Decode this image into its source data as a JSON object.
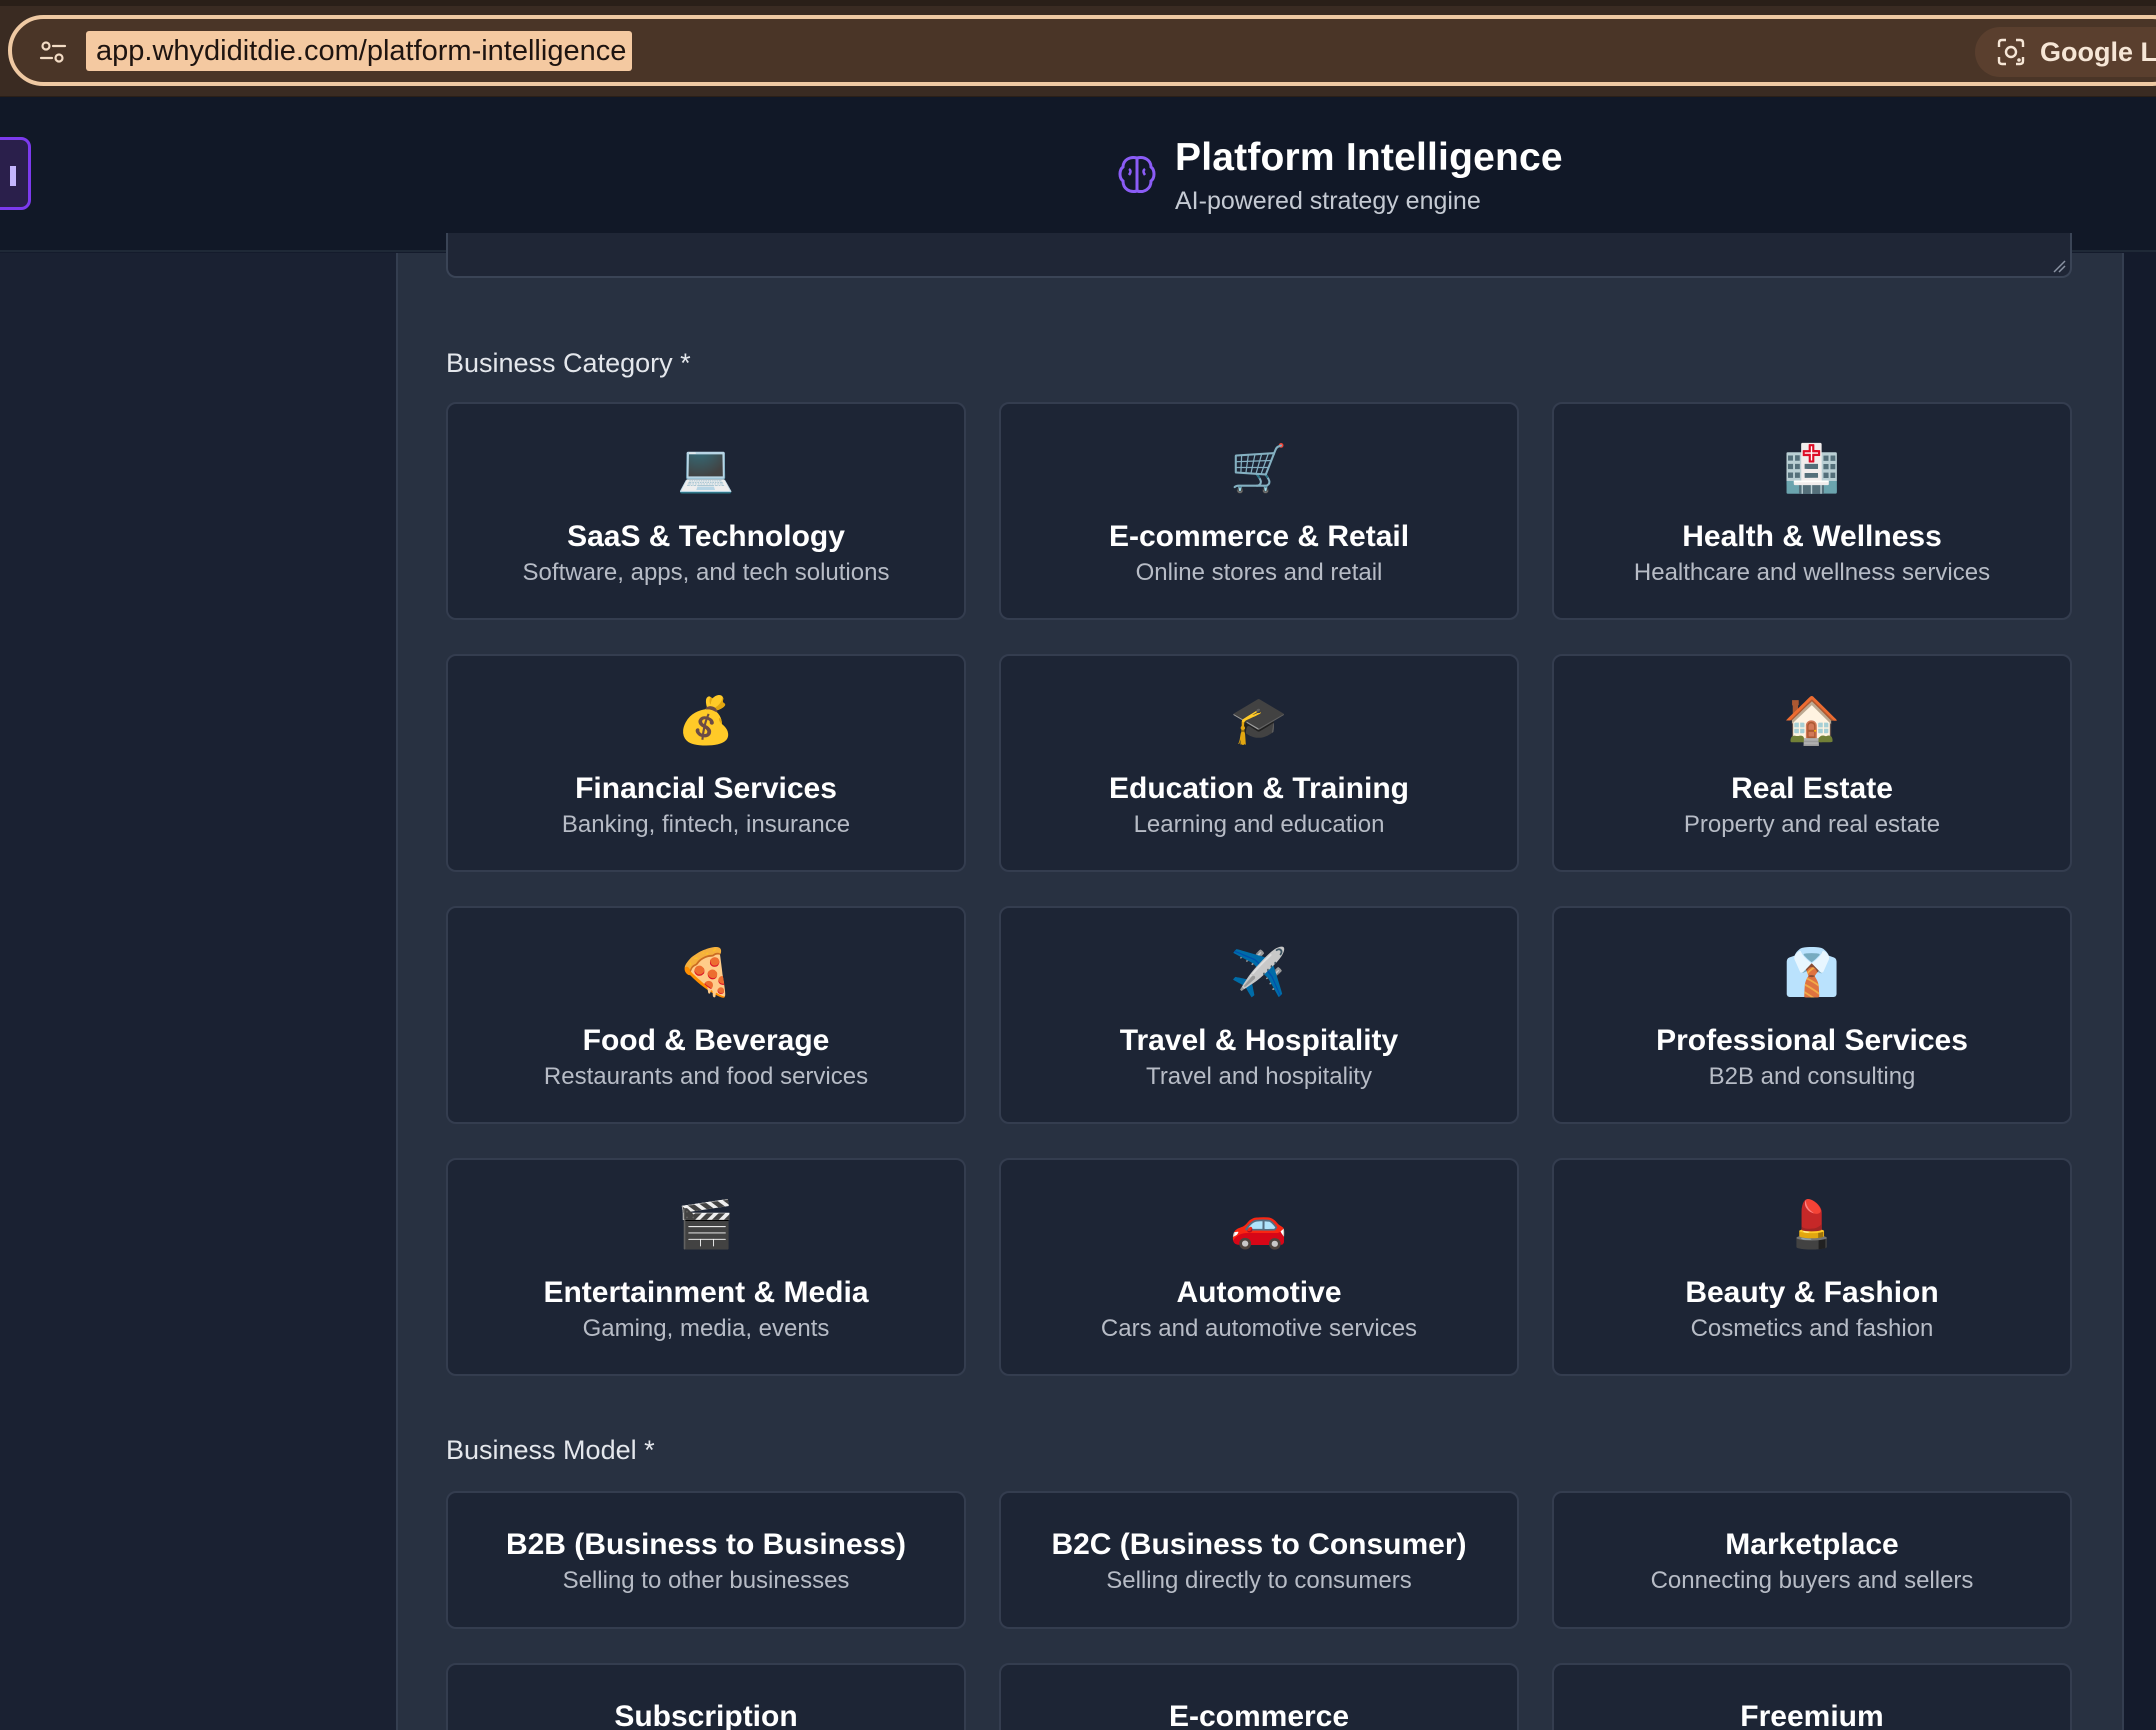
{
  "browser": {
    "url": "app.whydiditdie.com/platform-intelligence",
    "lens_label": "Google Le"
  },
  "header": {
    "title": "Platform Intelligence",
    "subtitle": "AI-powered strategy engine"
  },
  "business_category": {
    "label": "Business Category *",
    "items": [
      {
        "icon": "laptop-icon",
        "emoji": "💻",
        "title": "SaaS & Technology",
        "desc": "Software, apps, and tech solutions"
      },
      {
        "icon": "shopping-cart-icon",
        "emoji": "🛒",
        "title": "E-commerce & Retail",
        "desc": "Online stores and retail"
      },
      {
        "icon": "hospital-icon",
        "emoji": "🏥",
        "title": "Health & Wellness",
        "desc": "Healthcare and wellness services"
      },
      {
        "icon": "money-bag-icon",
        "emoji": "💰",
        "title": "Financial Services",
        "desc": "Banking, fintech, insurance"
      },
      {
        "icon": "graduation-cap-icon",
        "emoji": "🎓",
        "title": "Education & Training",
        "desc": "Learning and education"
      },
      {
        "icon": "house-icon",
        "emoji": "🏠",
        "title": "Real Estate",
        "desc": "Property and real estate"
      },
      {
        "icon": "pizza-icon",
        "emoji": "🍕",
        "title": "Food & Beverage",
        "desc": "Restaurants and food services"
      },
      {
        "icon": "airplane-icon",
        "emoji": "✈️",
        "title": "Travel & Hospitality",
        "desc": "Travel and hospitality"
      },
      {
        "icon": "necktie-icon",
        "emoji": "👔",
        "title": "Professional Services",
        "desc": "B2B and consulting"
      },
      {
        "icon": "clapper-board-icon",
        "emoji": "🎬",
        "title": "Entertainment & Media",
        "desc": "Gaming, media, events"
      },
      {
        "icon": "car-icon",
        "emoji": "🚗",
        "title": "Automotive",
        "desc": "Cars and automotive services"
      },
      {
        "icon": "lipstick-icon",
        "emoji": "💄",
        "title": "Beauty & Fashion",
        "desc": "Cosmetics and fashion"
      }
    ]
  },
  "business_model": {
    "label": "Business Model *",
    "items": [
      {
        "title": "B2B (Business to Business)",
        "desc": "Selling to other businesses"
      },
      {
        "title": "B2C (Business to Consumer)",
        "desc": "Selling directly to consumers"
      },
      {
        "title": "Marketplace",
        "desc": "Connecting buyers and sellers"
      },
      {
        "title": "Subscription",
        "desc": ""
      },
      {
        "title": "E-commerce",
        "desc": ""
      },
      {
        "title": "Freemium",
        "desc": ""
      }
    ]
  },
  "colors": {
    "accent": "#7c3aed",
    "brain_icon": "#8b5cf6",
    "omnibox_border": "#efc9a3"
  }
}
